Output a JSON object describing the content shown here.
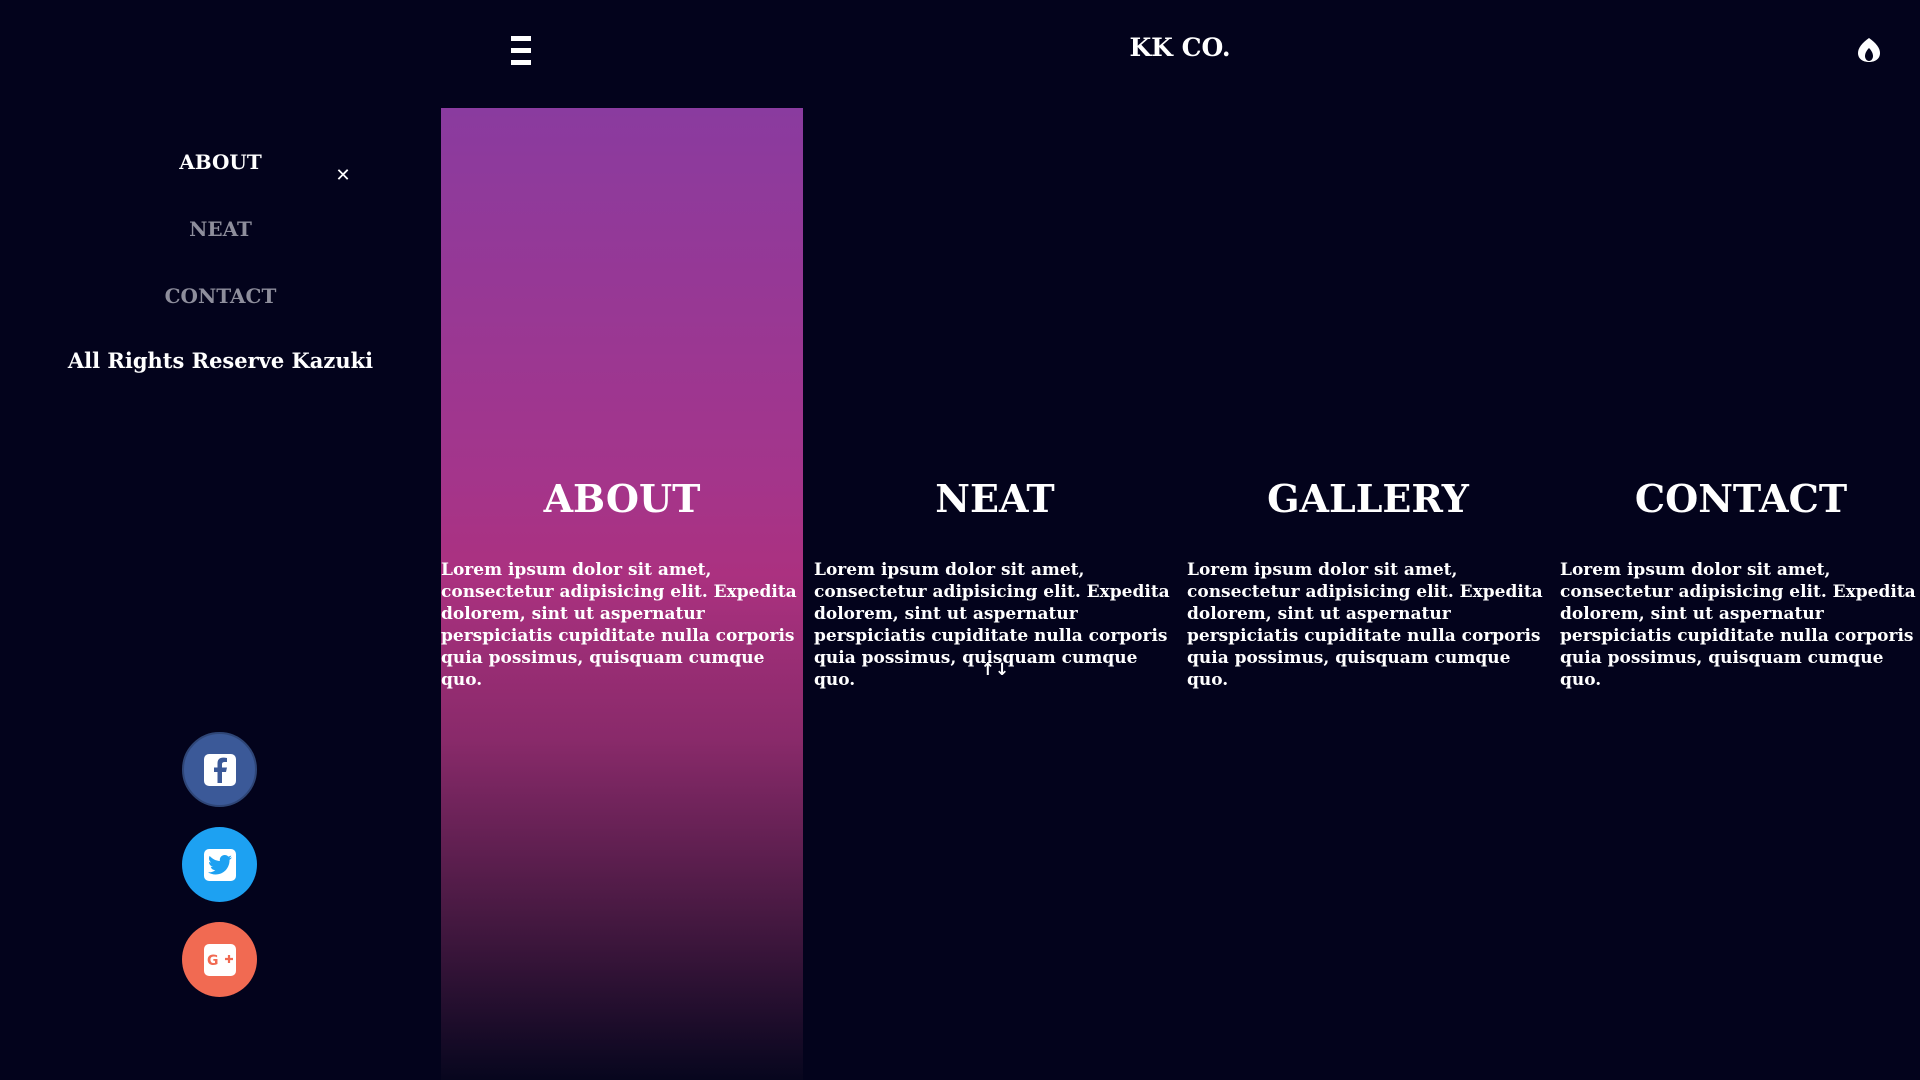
{
  "header": {
    "brand": "KK CO.",
    "menu_icon": "hamburger-icon",
    "logo_icon": "flame-drop-icon"
  },
  "sidebar": {
    "items": [
      {
        "label": "ABOUT",
        "active": true
      },
      {
        "label": "NEAT",
        "active": false
      },
      {
        "label": "CONTACT",
        "active": false
      }
    ],
    "close_icon": "close-icon",
    "close_glyph": "✕",
    "rights": "All Rights Reserve Kazuki",
    "social": [
      {
        "icon": "facebook-icon",
        "color": "#3b5998"
      },
      {
        "icon": "twitter-icon",
        "color": "#1da1f2"
      },
      {
        "icon": "google-plus-icon",
        "color": "#f16a52"
      }
    ]
  },
  "main": {
    "columns": [
      {
        "title": "ABOUT",
        "body": "Lorem ipsum dolor sit amet, consectetur adipisicing elit. Expedita dolorem, sint ut aspernatur perspiciatis cupiditate nulla corporis quia possimus, quisquam cumque quo."
      },
      {
        "title": "NEAT",
        "body": "Lorem ipsum dolor sit amet, consectetur adipisicing elit. Expedita dolorem, sint ut aspernatur perspiciatis cupiditate nulla corporis quia possimus, quisquam cumque quo."
      },
      {
        "title": "GALLERY",
        "body": "Lorem ipsum dolor sit amet, consectetur adipisicing elit. Expedita dolorem, sint ut aspernatur perspiciatis cupiditate nulla corporis quia possimus, quisquam cumque quo."
      },
      {
        "title": "CONTACT",
        "body": "Lorem ipsum dolor sit amet, consectetur adipisicing elit. Expedita dolorem, sint ut aspernatur perspiciatis cupiditate nulla corporis quia possimus, quisquam cumque quo."
      }
    ],
    "sort_glyph": "↑↓"
  },
  "colors": {
    "background": "#03031c",
    "gradient_top": "#8a3b9f",
    "gradient_mid": "#ab3180",
    "dim_text": "#8e8e9c"
  }
}
